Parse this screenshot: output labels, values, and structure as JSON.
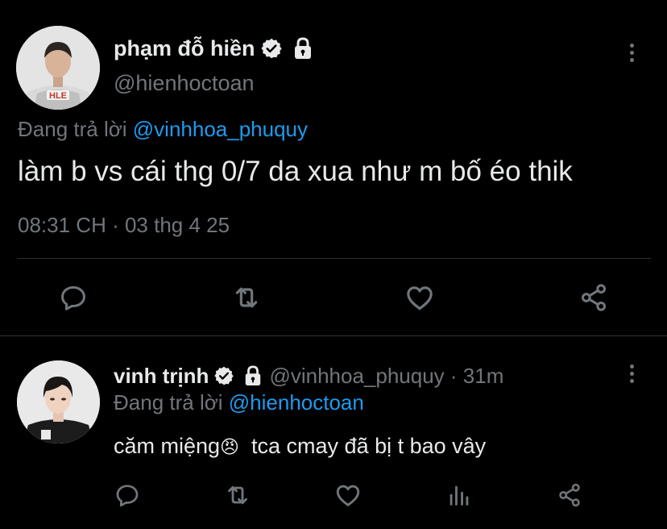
{
  "main_tweet": {
    "display_name": "phạm đỗ hiền",
    "handle": "@hienhoctoan",
    "reply_prefix": "Đang trả lời ",
    "reply_mention": "@vinhhoa_phuquy",
    "text": "làm b vs cái thg 0/7 da xua như m bố éo thik",
    "timestamp": "08:31 CH · 03 thg 4 25",
    "jersey_text": "HLE"
  },
  "reply_tweet": {
    "display_name": "vinh trịnh",
    "handle_time": "@vinhhoa_phuquy · 31m",
    "reply_prefix": "Đang trả lời ",
    "reply_mention": "@hienhoctoan",
    "text_before_emoji": "căm miệng",
    "emoji": "😠",
    "text_after_emoji": "  tca cmay đã bị t bao vây"
  },
  "icons": {
    "reply": "reply-icon",
    "retweet": "retweet-icon",
    "like": "heart-icon",
    "share": "share-icon",
    "views": "views-icon",
    "verified": "verified-badge-icon",
    "protected": "lock-icon",
    "more": "more-options-icon"
  },
  "colors": {
    "background": "#000000",
    "text": "#e7e9ea",
    "secondary": "#71767b",
    "link": "#1d9bf0",
    "divider": "#2f3336"
  }
}
